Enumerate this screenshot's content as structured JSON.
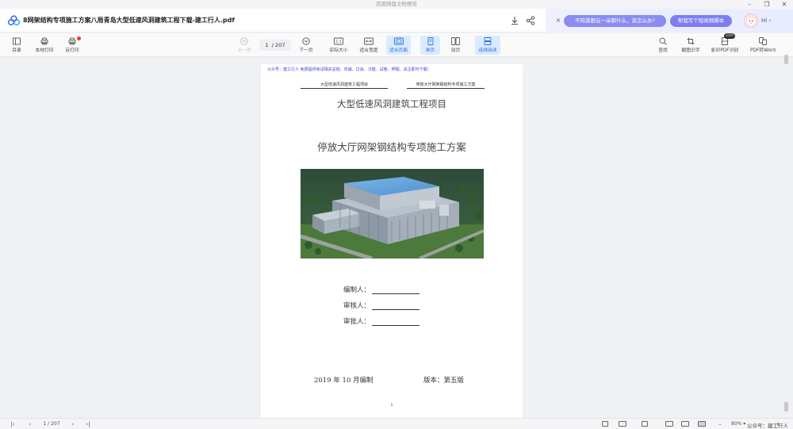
{
  "window": {
    "title": "百度网盘文档预览",
    "controls": {
      "minimize": "–",
      "restore": "❐",
      "close": "✕"
    }
  },
  "header": {
    "doc_title": "8网架结构专项施工方案八局青岛大型低速风洞建筑工程下载-建工行人.pdf",
    "icons": [
      "download-icon",
      "share-icon"
    ],
    "ai": {
      "close": "×",
      "prompt1": "不知道跟云一朵聊什么，该怎么办?",
      "prompt2": "帮我写个短视频脚本",
      "greeting": "Hi",
      "greeting_arrow": "›"
    }
  },
  "toolbar": {
    "left": [
      {
        "id": "toc",
        "label": "目录"
      },
      {
        "id": "local-print",
        "label": "本地打印"
      },
      {
        "id": "cloud-print",
        "label": "云打印"
      }
    ],
    "center": [
      {
        "id": "prev-page",
        "label": "上一页"
      },
      {
        "id": "next-page",
        "label": "下一页"
      },
      {
        "id": "actual-size",
        "label": "实际大小"
      },
      {
        "id": "fit-width",
        "label": "适合宽度"
      },
      {
        "id": "fit-page",
        "label": "适合页面"
      },
      {
        "id": "single-page",
        "label": "单页"
      },
      {
        "id": "double-page",
        "label": "双页"
      },
      {
        "id": "continuous",
        "label": "连续阅读"
      }
    ],
    "page": {
      "current": "1",
      "total": "/ 207"
    },
    "right": [
      {
        "id": "find",
        "label": "查找"
      },
      {
        "id": "screenshot-ocr",
        "label": "截图识字"
      },
      {
        "id": "scan-pdf",
        "label": "影印PDF识别"
      },
      {
        "id": "pdf-to-word",
        "label": "PDF转Word"
      }
    ],
    "vip_badge": "SVIP"
  },
  "page": {
    "promo": "公众号：建工行人 免费提供考试相关总结、背诵、口诀、习题、试卷、押题、关注即可下载！",
    "header_left": "大型低速风洞建筑工程项目",
    "header_right": "停放大厅网架钢结构专项施工方案",
    "project": "大型低速风洞建筑工程项目",
    "title": "停放大厅网架钢结构专项施工方案",
    "signatures": [
      "编制人：",
      "审核人：",
      "审批人："
    ],
    "date": "2019 年 10 月编制",
    "version": "版本：第五版",
    "number": "1"
  },
  "bottom": {
    "first": "|‹",
    "prev": "‹",
    "page": "1 / 207",
    "next": "›",
    "last": "›|",
    "zoom_minus": "–",
    "zoom": "80%",
    "zoom_plus": "+",
    "zoom_arrow": "▾",
    "watermark": "公众号：建工行人"
  },
  "colors": {
    "accent": "#2f6fd6",
    "active_bg": "#d9ebff",
    "promo_text": "#3b3bdf",
    "pill": "#8c8cf0"
  }
}
